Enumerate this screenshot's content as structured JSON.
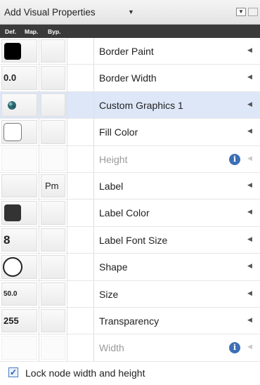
{
  "header": {
    "title": "Add Visual Properties",
    "dropdown_icon": "caret-down",
    "right_icon": "collapse-icon"
  },
  "columns": {
    "def": "Def.",
    "map": "Map.",
    "byp": "Byp."
  },
  "properties": [
    {
      "name": "Border Paint",
      "default": "",
      "default_kind": "swatch-black",
      "mapping": "",
      "enabled": true
    },
    {
      "name": "Border Width",
      "default": "0.0",
      "default_kind": "text",
      "mapping": "",
      "enabled": true
    },
    {
      "name": "Custom Graphics 1",
      "default": "",
      "default_kind": "custom-graphics",
      "mapping": "",
      "enabled": true,
      "selected": true
    },
    {
      "name": "Fill Color",
      "default": "",
      "default_kind": "swatch-white",
      "mapping": "",
      "enabled": true
    },
    {
      "name": "Height",
      "default": "",
      "default_kind": "none",
      "mapping": "",
      "enabled": false
    },
    {
      "name": "Label",
      "default": "",
      "default_kind": "none",
      "mapping": "Pm",
      "enabled": true
    },
    {
      "name": "Label Color",
      "default": "",
      "default_kind": "swatch-dark",
      "mapping": "",
      "enabled": true
    },
    {
      "name": "Label Font Size",
      "default": "8",
      "default_kind": "text-big",
      "mapping": "",
      "enabled": true
    },
    {
      "name": "Shape",
      "default": "",
      "default_kind": "circle",
      "mapping": "",
      "enabled": true
    },
    {
      "name": "Size",
      "default": "50.0",
      "default_kind": "text-small",
      "mapping": "",
      "enabled": true
    },
    {
      "name": "Transparency",
      "default": "255",
      "default_kind": "text",
      "mapping": "",
      "enabled": true
    },
    {
      "name": "Width",
      "default": "",
      "default_kind": "none",
      "mapping": "",
      "enabled": false
    }
  ],
  "footer": {
    "lock_label": "Lock node width and height",
    "lock_checked": true
  },
  "colors": {
    "header_bar": "#3a3a3a",
    "selected_row": "#dde7f8",
    "info_icon": "#3d6fb6"
  }
}
